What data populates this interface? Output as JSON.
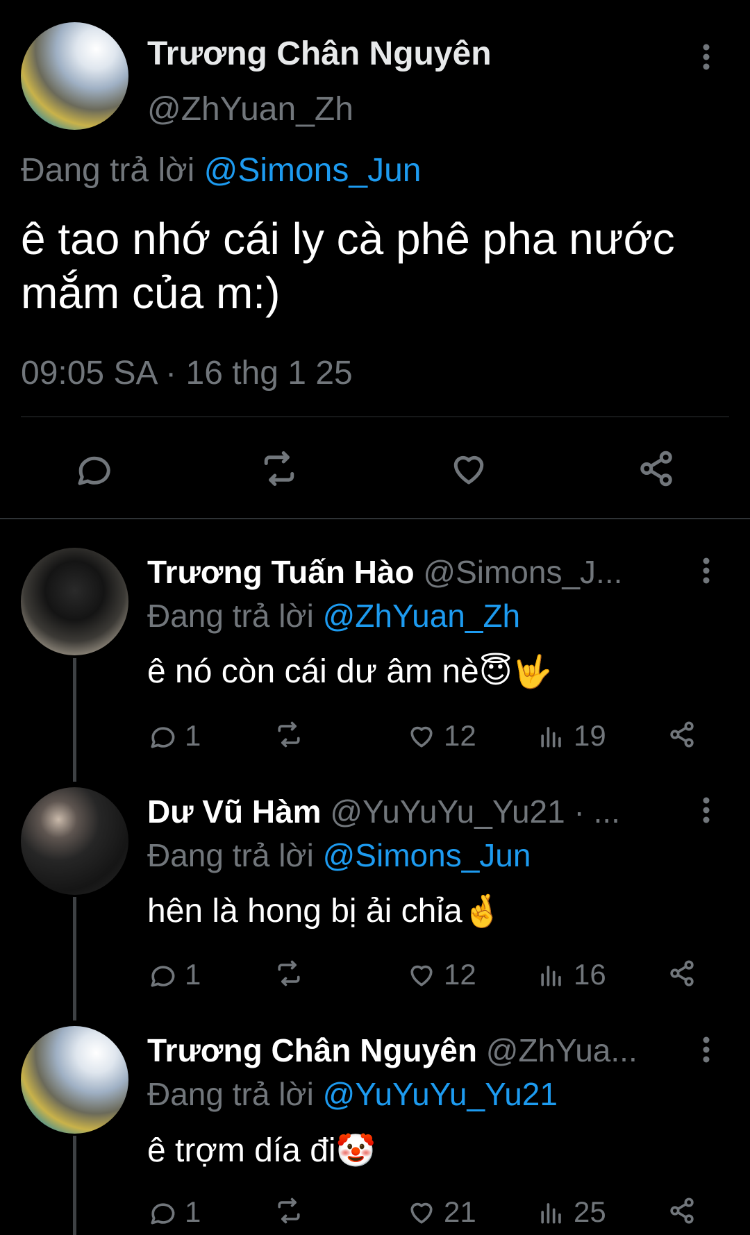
{
  "main_tweet": {
    "name": "Trương Chân Nguyên",
    "handle": "@ZhYuan_Zh",
    "reply_prefix": "Đang trả lời",
    "reply_to": "@Simons_Jun",
    "text": "ê tao nhớ cái ly cà phê pha nước mắm của m:)",
    "timestamp": "09:05 SA · 16 thg 1 25",
    "actions": [
      "reply-icon",
      "retweet-icon",
      "like-icon",
      "share-icon"
    ]
  },
  "replies": [
    {
      "name": "Trương Tuấn Hào",
      "handle": "@Simons_J...",
      "reply_prefix": "Đang trả lời",
      "reply_to": "@ZhYuan_Zh",
      "text": "ê nó còn cái dư âm nè",
      "emojis": "😇🤟",
      "reply_count": "1",
      "like_count": "12",
      "view_count": "19"
    },
    {
      "name": "Dư Vũ Hàm",
      "handle": "@YuYuYu_Yu21 · ...",
      "reply_prefix": "Đang trả lời",
      "reply_to": "@Simons_Jun",
      "text": "hên là hong bị ải chỉa",
      "emojis": "🤞",
      "reply_count": "1",
      "like_count": "12",
      "view_count": "16"
    },
    {
      "name": "Trương Chân Nguyên",
      "handle": "@ZhYua...",
      "reply_prefix": "Đang trả lời",
      "reply_to": "@YuYuYu_Yu21",
      "text": "ê trợm día đi",
      "emojis": "🤡",
      "reply_count": "1",
      "like_count": "21",
      "view_count": "25"
    }
  ],
  "colors": {
    "background": "#000000",
    "text": "#e7e9ea",
    "muted": "#71767b",
    "accent": "#1d9bf0",
    "divider": "#2f3336"
  }
}
